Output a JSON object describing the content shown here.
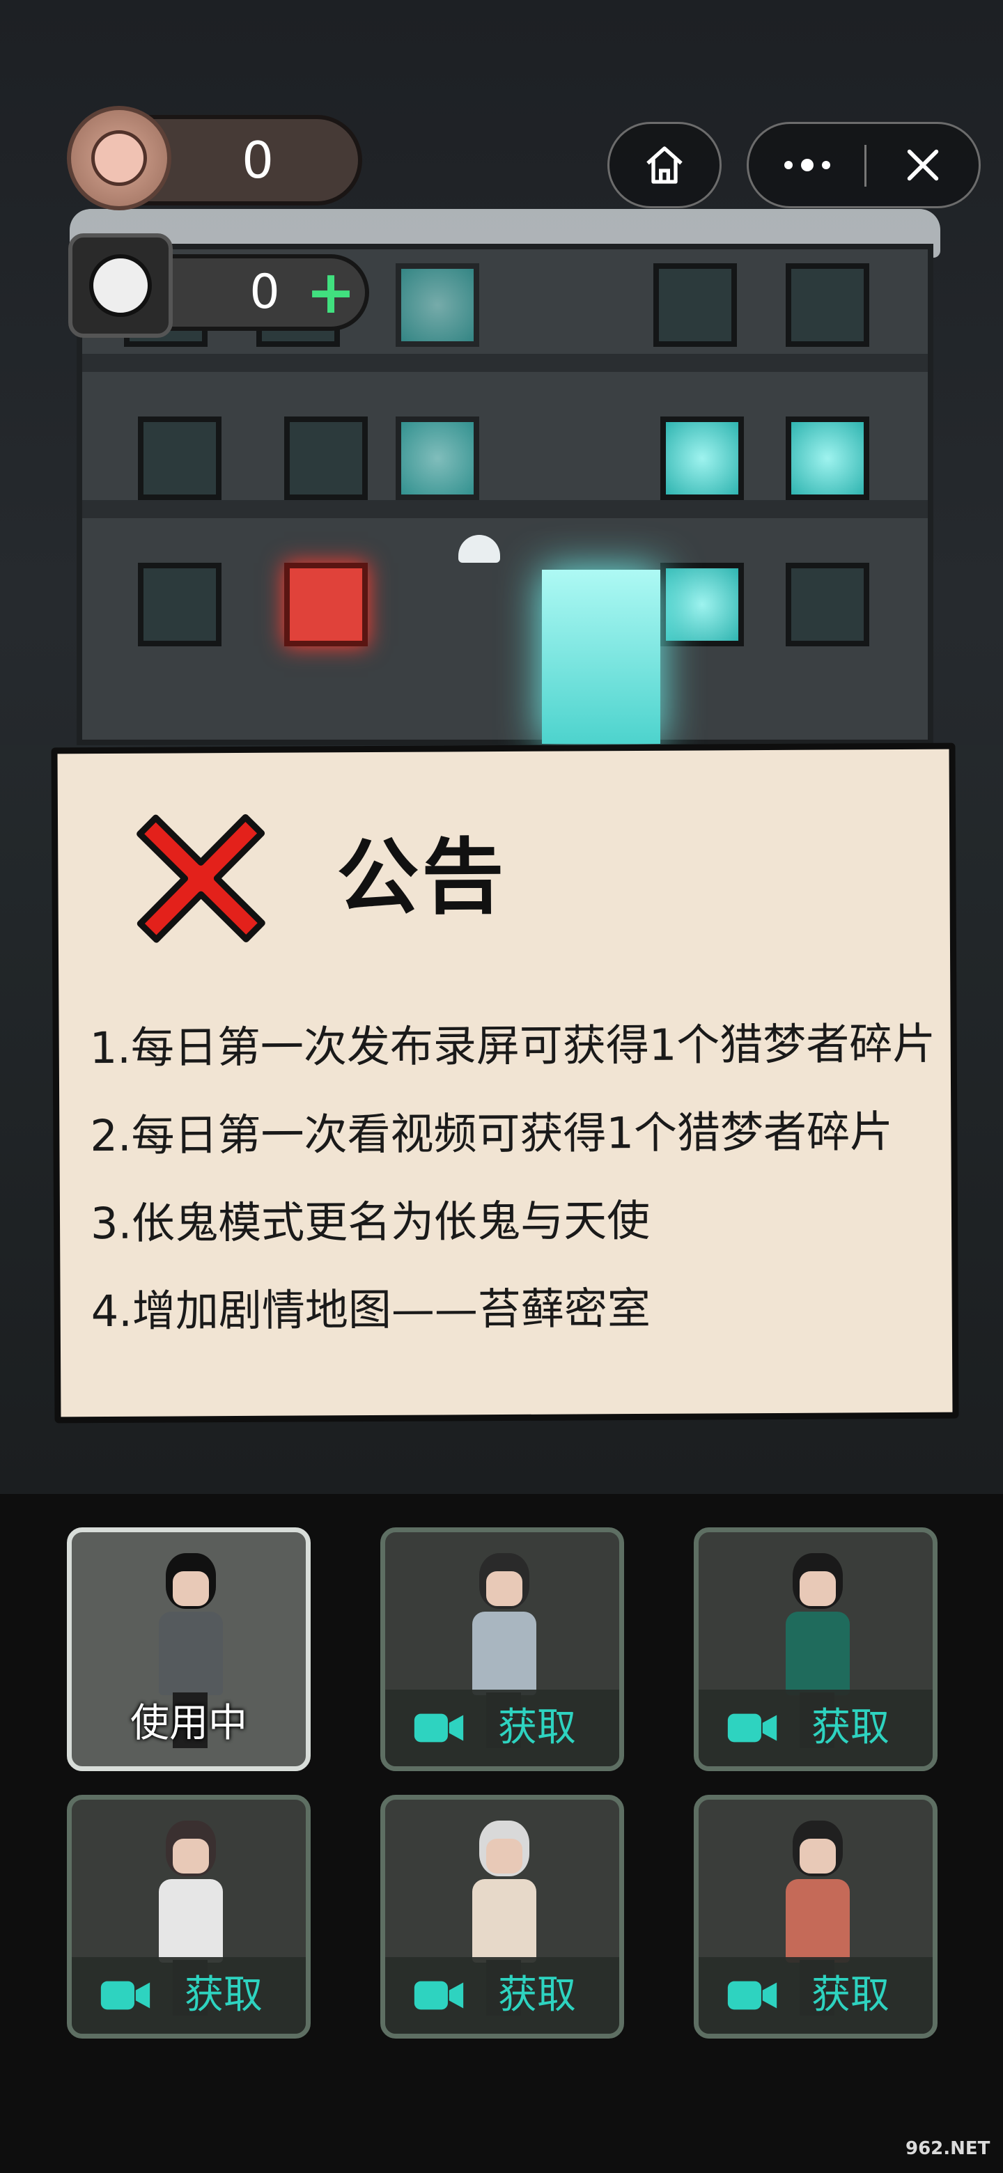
{
  "hud": {
    "coins": "0",
    "shards": "0",
    "add_icon": "plus-icon",
    "coin_icon": "pig-face-icon",
    "shard_icon": "puzzle-piece-icon"
  },
  "capsule": {
    "home_icon": "home-icon",
    "more_icon": "more-icon",
    "close_icon": "close-icon"
  },
  "notice": {
    "title": "公告",
    "close_icon": "red-x-icon",
    "lines": [
      "1.每日第一次发布录屏可获得1个猎梦者碎片",
      "2.每日第一次看视频可获得1个猎梦者碎片",
      "3.伥鬼模式更名为伥鬼与天使",
      "4.增加剧情地图——苔藓密室"
    ]
  },
  "characters": [
    {
      "status": "使用中",
      "body_color": "#555a5d",
      "hair": "#111111"
    },
    {
      "action": "获取",
      "body_color": "#a9b6c0",
      "hair": "#2a2a2a"
    },
    {
      "action": "获取",
      "body_color": "#1f6b5c",
      "hair": "#1a1a1a"
    },
    {
      "action": "获取",
      "body_color": "#e6e6e6",
      "hair": "#3a3030"
    },
    {
      "action": "获取",
      "body_color": "#e7d9c9",
      "hair": "#d9d9d9"
    },
    {
      "action": "获取",
      "body_color": "#c56a58",
      "hair": "#202020"
    }
  ],
  "colors": {
    "accent_teal": "#2ed3c0",
    "plus_green": "#41e07f",
    "x_red": "#e3211b",
    "paper": "#f1e4d3"
  },
  "watermark": "962.NET"
}
